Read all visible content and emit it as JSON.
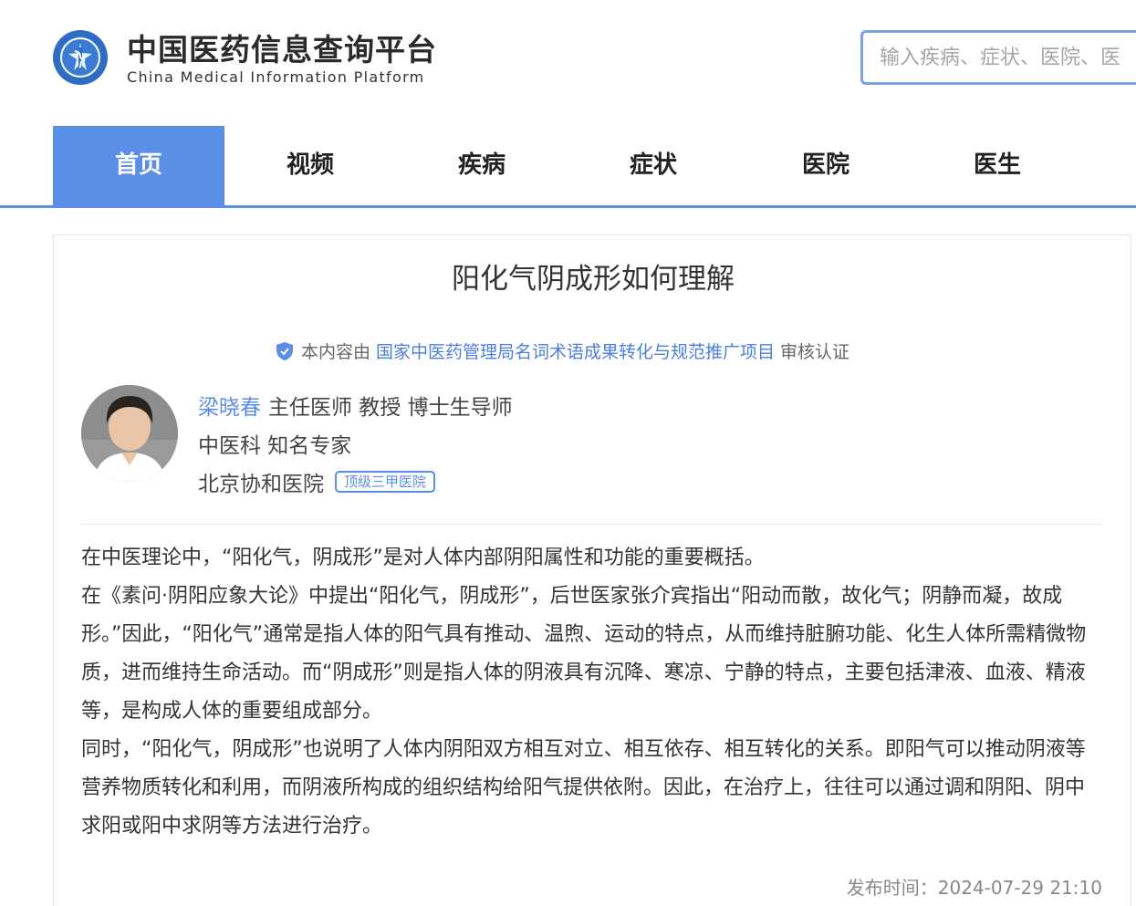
{
  "header": {
    "title_cn": "中国医药信息查询平台",
    "title_en": "China Medical Information Platform",
    "logo_icon": "platform-logo"
  },
  "search": {
    "placeholder": "输入疾病、症状、医院、医"
  },
  "nav": {
    "items": [
      {
        "label": "首页",
        "active": true
      },
      {
        "label": "视频"
      },
      {
        "label": "疾病"
      },
      {
        "label": "症状"
      },
      {
        "label": "医院"
      },
      {
        "label": "医生"
      }
    ]
  },
  "article": {
    "title": "阳化气阴成形如何理解",
    "verify": {
      "prefix": "本内容由",
      "org": "国家中医药管理局名词术语成果转化与规范推广项目",
      "suffix": "审核认证",
      "icon": "verified-shield-icon"
    },
    "doctor": {
      "name": "梁晓春",
      "titles": "主任医师 教授 博士生导师",
      "dept": "中医科 知名专家",
      "hospital": "北京协和医院",
      "hospital_badge": "顶级三甲医院"
    },
    "paragraphs": [
      "在中医理论中，“阳化气，阴成形”是对人体内部阴阳属性和功能的重要概括。",
      "在《素问·阴阳应象大论》中提出“阳化气，阴成形”，后世医家张介宾指出“阳动而散，故化气；阴静而凝，故成形。”因此，“阳化气”通常是指人体的阳气具有推动、温煦、运动的特点，从而维持脏腑功能、化生人体所需精微物质，进而维持生命活动。而“阴成形”则是指人体的阴液具有沉降、寒凉、宁静的特点，主要包括津液、血液、精液等，是构成人体的重要组成部分。",
      "同时，“阳化气，阴成形”也说明了人体内阴阳双方相互对立、相互依存、相互转化的关系。即阳气可以推动阴液等营养物质转化和利用，而阴液所构成的组织结构给阳气提供依附。因此，在治疗上，往往可以通过调和阴阳、阴中求阳或阳中求阴等方法进行治疗。"
    ],
    "publish_time": "发布时间：2024-07-29 21:10"
  },
  "colors": {
    "accent": "#5b8ee6",
    "link": "#4a7ee0"
  }
}
